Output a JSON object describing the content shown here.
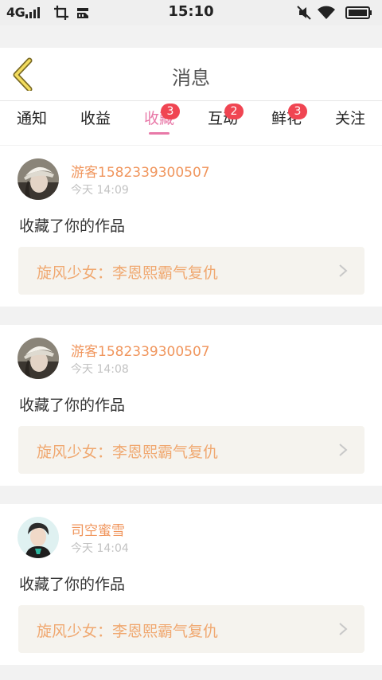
{
  "status_bar": {
    "network": "4G",
    "time": "15:10",
    "icons": [
      "signal-icon",
      "crop-icon",
      "sd-card-icon",
      "mute-icon",
      "wifi-icon",
      "battery-icon"
    ]
  },
  "header": {
    "title": "消息",
    "back_icon": "chevron-left-icon"
  },
  "tabs": [
    {
      "label": "通知",
      "badge": null,
      "active": false
    },
    {
      "label": "收益",
      "badge": null,
      "active": false
    },
    {
      "label": "收藏",
      "badge": "3",
      "active": true
    },
    {
      "label": "互动",
      "badge": "2",
      "active": false
    },
    {
      "label": "鲜花",
      "badge": "3",
      "active": false
    },
    {
      "label": "关注",
      "badge": null,
      "active": false
    }
  ],
  "messages": [
    {
      "username": "游客1582339300507",
      "time": "今天 14:09",
      "action": "收藏了你的作品",
      "work_title": "旋风少女：李恩熙霸气复仇"
    },
    {
      "username": "游客1582339300507",
      "time": "今天 14:08",
      "action": "收藏了你的作品",
      "work_title": "旋风少女：李恩熙霸气复仇"
    },
    {
      "username": "司空蜜雪",
      "time": "今天 14:04",
      "action": "收藏了你的作品",
      "work_title": "旋风少女：李恩熙霸气复仇"
    }
  ],
  "colors": {
    "accent_pink": "#e879a8",
    "username_orange": "#f0955c",
    "work_title_orange": "#f0a870",
    "badge_red": "#f04552",
    "page_background": "#f2f2f2"
  }
}
